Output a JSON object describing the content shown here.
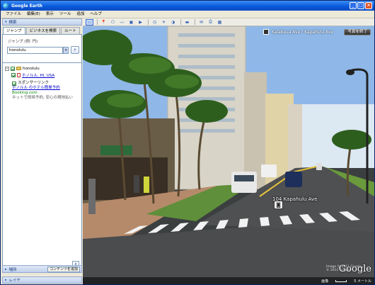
{
  "window": {
    "title": "Google Earth",
    "min_label": "_",
    "max_label": "□",
    "close_label": "×"
  },
  "menu": [
    "ファイル",
    "編集(E)",
    "表示",
    "ツール",
    "追加",
    "ヘルプ"
  ],
  "search_panel": {
    "header": "検索",
    "tabs": [
      "ジャンプ",
      "ビジネスを検索",
      "ルート"
    ],
    "field_label": "ジャンプ (例: 円)",
    "query": "honolulu",
    "results": {
      "folder_label": "honolulu",
      "result_label": "ホノルル, HI, USA",
      "sponsored": {
        "heading": "スポンサーリンク",
        "title": "ホノルル のホテル簡単予約",
        "url": "Booking.com",
        "text": "ネットで即時予約, 安心の現地払い"
      }
    },
    "close_label": "x"
  },
  "places": {
    "label": "場所",
    "add_button": "コンテンツを追加"
  },
  "layers": {
    "label": "レイヤ"
  },
  "streetview": {
    "address": "Kalakaua Ave / Kapahulu Ave",
    "exit_button": "写真を終了",
    "road_label": "104 Kapahulu Ave",
    "attribution_line1": "Image © 2011 Google",
    "attribution_line2": "© 2011 Google",
    "google_logo": "Google",
    "status_left": "画像",
    "status_scale": "5 メートル"
  },
  "colors": {
    "title_bar": "#0a5bdc",
    "sky": "#8fb8e8",
    "road": "#4a4c4e",
    "grass": "#5f8f3a"
  }
}
